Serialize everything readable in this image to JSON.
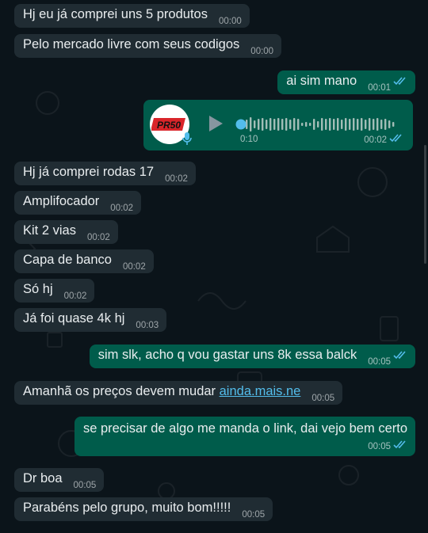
{
  "colors": {
    "background": "#0b141a",
    "incoming_bubble": "#202c33",
    "outgoing_bubble": "#005c4b",
    "read_ticks": "#53bdeb",
    "link": "#53bdeb"
  },
  "messages": [
    {
      "text": "Hj eu já comprei uns 5 produtos",
      "time": "00:00"
    },
    {
      "text": "Pelo mercado livre com seus codigos",
      "time": "00:00"
    },
    {
      "text": "ai sim mano",
      "time": "00:01",
      "status_icon": "double-check-read-icon"
    },
    {
      "duration": "0:10",
      "time": "00:02",
      "status_icon": "double-check-read-icon",
      "avatar_text": "PR50",
      "play_icon": "play-icon",
      "mic_icon": "mic-icon"
    },
    {
      "text": "Hj já comprei rodas 17",
      "time": "00:02"
    },
    {
      "text": "Amplifocador",
      "time": "00:02"
    },
    {
      "text": "Kit 2 vias",
      "time": "00:02"
    },
    {
      "text": "Capa de banco",
      "time": "00:02"
    },
    {
      "text": "Só hj",
      "time": "00:02"
    },
    {
      "text": "Já foi quase 4k hj",
      "time": "00:03"
    },
    {
      "text": "sim slk, acho q vou gastar uns 8k essa balck",
      "time": "00:05",
      "status_icon": "double-check-read-icon"
    },
    {
      "text": "Amanhã os preços devem mudar ",
      "link": "ainda.mais.ne",
      "time": "00:05"
    },
    {
      "text": "se precisar de algo me manda o link, dai vejo bem certo",
      "time": "00:05",
      "status_icon": "double-check-read-icon"
    },
    {
      "text": "Dr boa",
      "time": "00:05"
    },
    {
      "text": "Parabéns pelo grupo, muito bom!!!!!",
      "time": "00:05"
    }
  ]
}
